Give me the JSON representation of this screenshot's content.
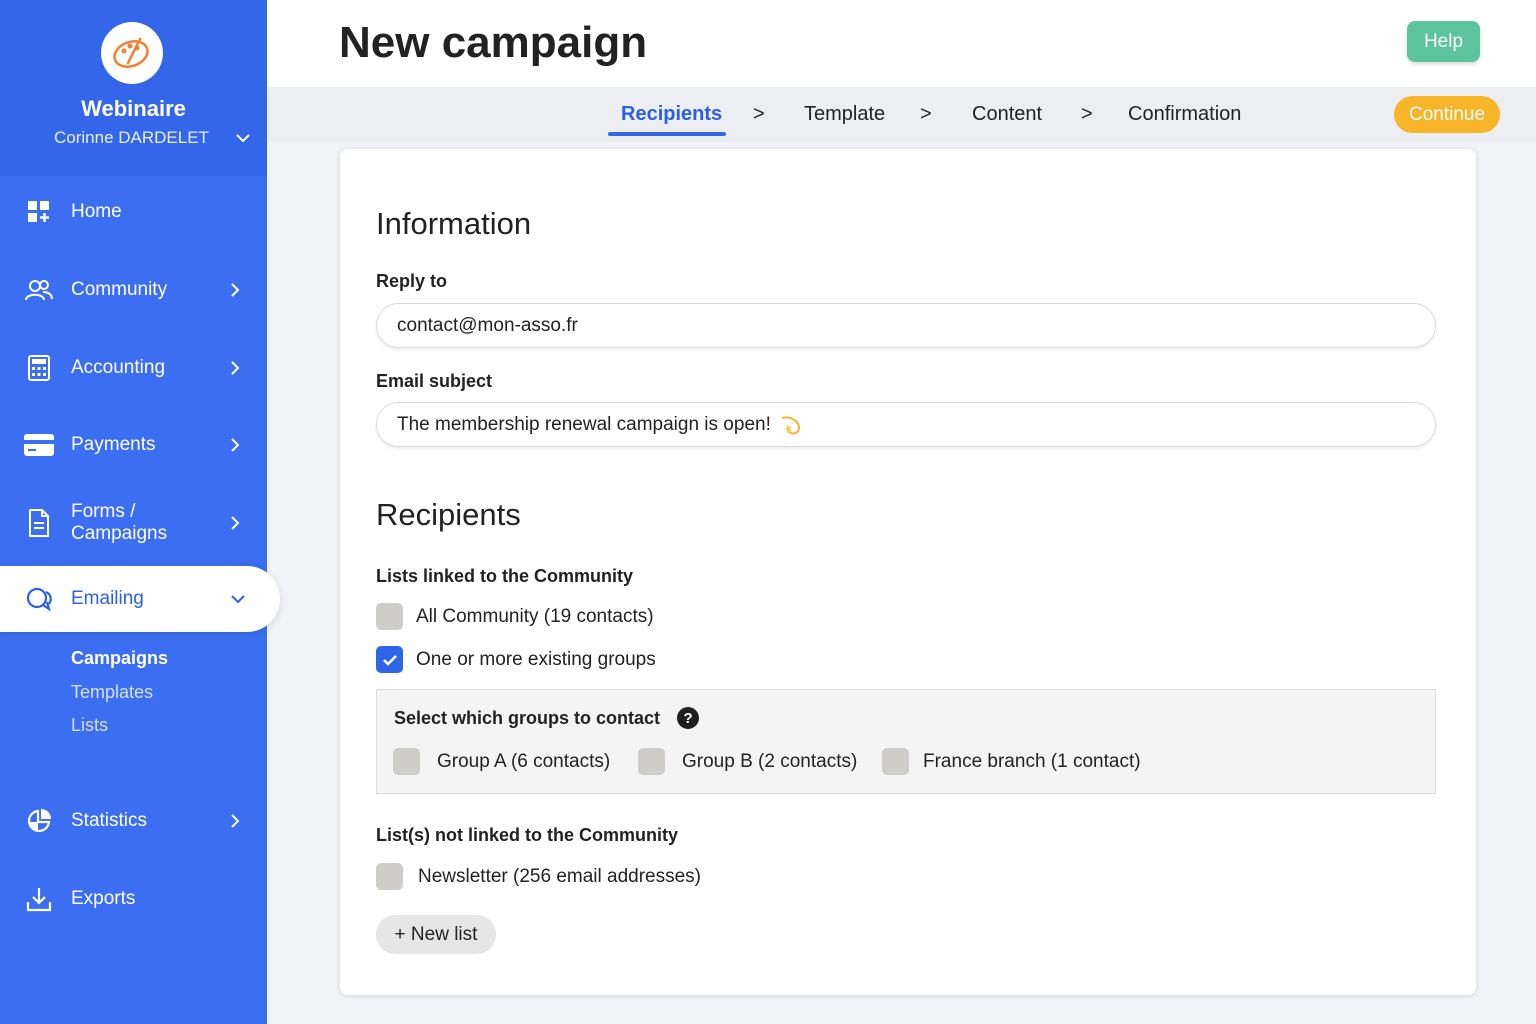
{
  "sidebar": {
    "org_name": "Webinaire",
    "user_name": "Corinne DARDELET",
    "items": [
      {
        "label": "Home"
      },
      {
        "label": "Community"
      },
      {
        "label": "Accounting"
      },
      {
        "label": "Payments"
      },
      {
        "label": "Forms / Campaigns"
      },
      {
        "label": "Emailing"
      },
      {
        "label": "Statistics"
      },
      {
        "label": "Exports"
      }
    ],
    "subitems": [
      {
        "label": "Campaigns"
      },
      {
        "label": "Templates"
      },
      {
        "label": "Lists"
      }
    ]
  },
  "header": {
    "title": "New campaign",
    "help_label": "Help"
  },
  "steps": {
    "items": [
      {
        "label": "Recipients"
      },
      {
        "label": "Template"
      },
      {
        "label": "Content"
      },
      {
        "label": "Confirmation"
      }
    ],
    "separator": ">",
    "continue_label": "Continue"
  },
  "form": {
    "info_heading": "Information",
    "reply_to_label": "Reply to",
    "reply_to_value": "contact@mon-asso.fr",
    "subject_label": "Email subject",
    "subject_value": "The membership renewal campaign is open!",
    "recipients_heading": "Recipients",
    "linked_label": "Lists linked to the Community",
    "all_community": "All Community (19 contacts)",
    "existing_groups": "One or more existing groups",
    "groups_title": "Select which groups to contact",
    "groups_help": "?",
    "groups": [
      {
        "label": "Group A (6 contacts)"
      },
      {
        "label": "Group B (2 contacts)"
      },
      {
        "label": "France branch (1 contact)"
      }
    ],
    "not_linked_label": "List(s) not linked to the Community",
    "newsletter": "Newsletter (256 email addresses)",
    "new_list_label": "+ New list"
  }
}
